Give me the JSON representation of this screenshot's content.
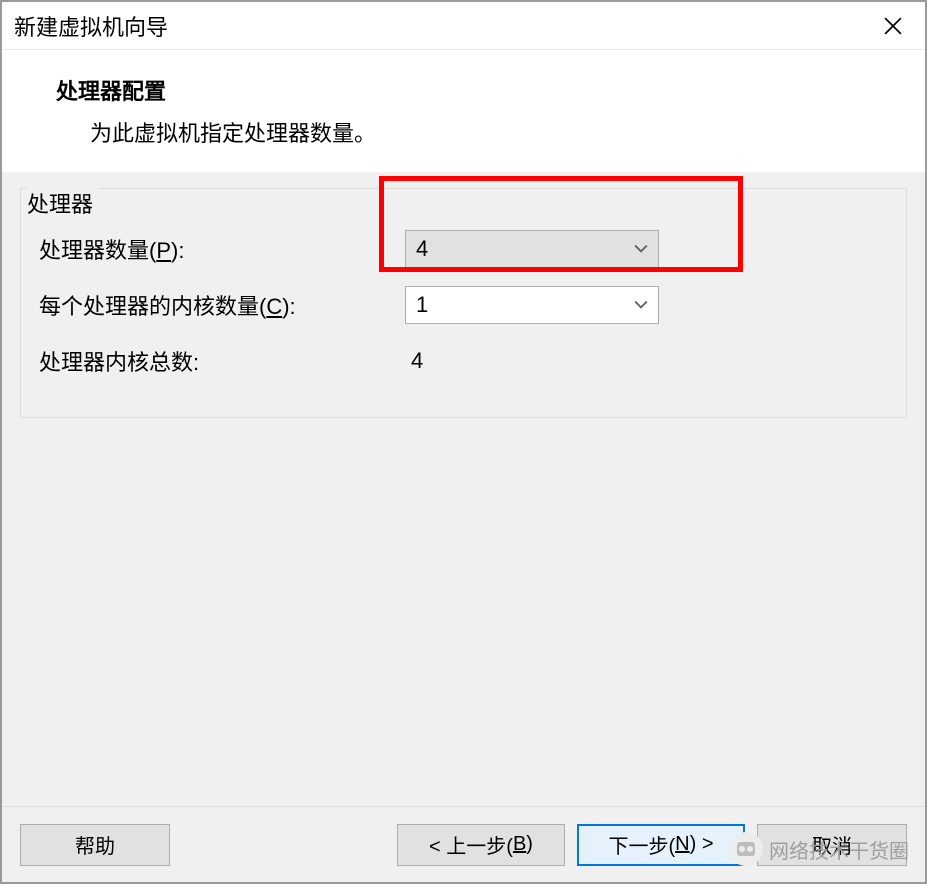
{
  "window": {
    "title": "新建虚拟机向导"
  },
  "header": {
    "heading": "处理器配置",
    "subheading": "为此虚拟机指定处理器数量。"
  },
  "group": {
    "legend": "处理器",
    "rows": {
      "proc_count": {
        "label_prefix": "处理器数量(",
        "label_hotkey": "P",
        "label_suffix": "):",
        "value": "4"
      },
      "cores_per_proc": {
        "label_prefix": "每个处理器的内核数量(",
        "label_hotkey": "C",
        "label_suffix": "):",
        "value": "1"
      },
      "total_cores": {
        "label": "处理器内核总数:",
        "value": "4"
      }
    }
  },
  "footer": {
    "help": "帮助",
    "prev_prefix": "< 上一步(",
    "prev_hotkey": "B",
    "prev_suffix": ")",
    "next_prefix": "下一步(",
    "next_hotkey": "N",
    "next_suffix": ") >",
    "cancel": "取消"
  },
  "watermark": {
    "text": "网络技术干货圈"
  }
}
